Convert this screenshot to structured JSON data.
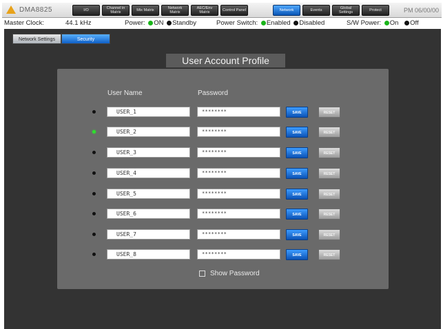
{
  "header": {
    "brand": "DMA8825",
    "time": "PM 06/00/00",
    "nav": [
      {
        "label": "I/O"
      },
      {
        "label": "Channel in Matrix"
      },
      {
        "label": "Mix Matrix"
      },
      {
        "label": "Network Matrix"
      },
      {
        "label": "AEC/Env Matrix"
      },
      {
        "label": "Control Panel"
      },
      {
        "label": "Network",
        "active": true
      },
      {
        "label": "Events"
      },
      {
        "label": "Global Settings"
      },
      {
        "label": "Protect"
      }
    ]
  },
  "status": {
    "master_clock_label": "Master Clock:",
    "master_clock_value": "44.1 kHz",
    "power_label": "Power:",
    "power_on": "ON",
    "power_standby": "Standby",
    "power_switch_label": "Power Switch:",
    "power_switch_enabled": "Enabled",
    "power_switch_disabled": "Disabled",
    "sw_power_label": "S/W Power:",
    "sw_power_on": "On",
    "sw_power_off": "Off"
  },
  "subtabs": [
    {
      "label": "Network Settings"
    },
    {
      "label": "Security",
      "active": true
    }
  ],
  "profile": {
    "title": "User Account Profile",
    "col_user": "User Name",
    "col_password": "Password",
    "save_label": "SAVE",
    "reset_label": "RESET",
    "show_password": "Show Password",
    "users": [
      {
        "name": "USER_1",
        "password": "********",
        "active": false
      },
      {
        "name": "USER_2",
        "password": "********",
        "active": true
      },
      {
        "name": "USER_3",
        "password": "********",
        "active": false
      },
      {
        "name": "USER_4",
        "password": "********",
        "active": false
      },
      {
        "name": "USER_5",
        "password": "********",
        "active": false
      },
      {
        "name": "USER_6",
        "password": "********",
        "active": false
      },
      {
        "name": "USER_7",
        "password": "********",
        "active": false
      },
      {
        "name": "USER_8",
        "password": "********",
        "active": false
      }
    ]
  },
  "colors": {
    "accent_blue": "#1a6fd6",
    "panel_bg": "#6a6a6a",
    "main_bg": "#333333",
    "indicator_on": "#2ee02e"
  }
}
